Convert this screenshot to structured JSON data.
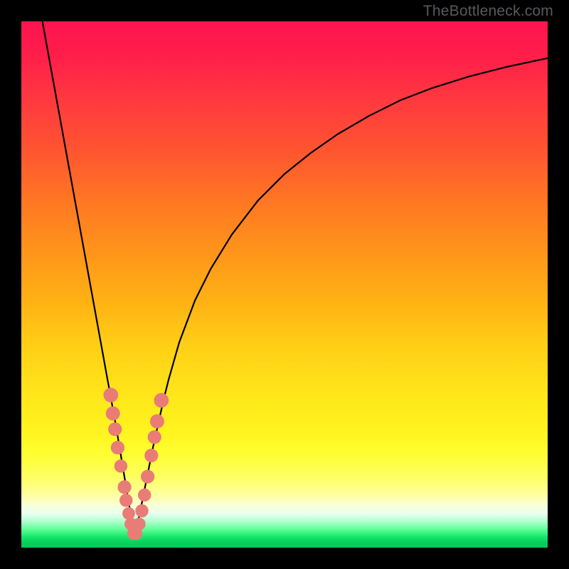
{
  "attribution": "TheBottleneck.com",
  "chart_data": {
    "type": "line",
    "title": "",
    "xlabel": "",
    "ylabel": "",
    "xlim": [
      0,
      100
    ],
    "ylim": [
      0,
      100
    ],
    "notch_x": 21.5,
    "series": [
      {
        "name": "curve",
        "x": [
          4,
          6,
          8,
          10,
          12,
          14,
          15,
          16,
          17,
          18,
          19,
          20,
          21,
          21.5,
          22,
          23,
          24,
          25,
          26,
          27,
          28,
          30,
          33,
          36,
          40,
          45,
          50,
          55,
          60,
          66,
          72,
          78,
          85,
          92,
          100
        ],
        "y": [
          100,
          89,
          78,
          67,
          56,
          45,
          39.5,
          34,
          28.5,
          23,
          17,
          11,
          5,
          2,
          4,
          9,
          14,
          19,
          23.5,
          28,
          32,
          39,
          47,
          53,
          59.5,
          66,
          71,
          75,
          78.5,
          82,
          85,
          87.3,
          89.5,
          91.3,
          93
        ]
      }
    ],
    "markers": [
      {
        "x": 17.0,
        "y": 29.0,
        "r": 1.4
      },
      {
        "x": 17.4,
        "y": 25.5,
        "r": 1.35
      },
      {
        "x": 17.8,
        "y": 22.5,
        "r": 1.3
      },
      {
        "x": 18.3,
        "y": 19.0,
        "r": 1.3
      },
      {
        "x": 18.9,
        "y": 15.5,
        "r": 1.25
      },
      {
        "x": 19.6,
        "y": 11.5,
        "r": 1.3
      },
      {
        "x": 19.9,
        "y": 9.0,
        "r": 1.25
      },
      {
        "x": 20.4,
        "y": 6.5,
        "r": 1.2
      },
      {
        "x": 20.8,
        "y": 4.5,
        "r": 1.2
      },
      {
        "x": 21.3,
        "y": 2.7,
        "r": 1.2
      },
      {
        "x": 21.8,
        "y": 2.7,
        "r": 1.2
      },
      {
        "x": 22.4,
        "y": 4.5,
        "r": 1.2
      },
      {
        "x": 22.9,
        "y": 7.0,
        "r": 1.25
      },
      {
        "x": 23.4,
        "y": 10.0,
        "r": 1.25
      },
      {
        "x": 24.0,
        "y": 13.5,
        "r": 1.3
      },
      {
        "x": 24.7,
        "y": 17.5,
        "r": 1.3
      },
      {
        "x": 25.3,
        "y": 21.0,
        "r": 1.3
      },
      {
        "x": 25.8,
        "y": 24.0,
        "r": 1.35
      },
      {
        "x": 26.6,
        "y": 28.0,
        "r": 1.4
      }
    ],
    "background": {
      "type": "vertical-gradient",
      "stops": [
        {
          "pos": 0,
          "color": "#ff1351"
        },
        {
          "pos": 50,
          "color": "#ffb016"
        },
        {
          "pos": 80,
          "color": "#fffe30"
        },
        {
          "pos": 100,
          "color": "#06c858"
        }
      ]
    }
  }
}
